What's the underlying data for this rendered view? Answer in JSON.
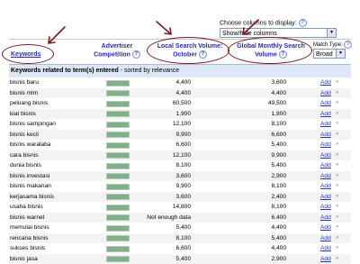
{
  "columns_control": {
    "label": "Choose columns to display:",
    "help": "?",
    "select_value": "Show/hide columns"
  },
  "headers": {
    "keywords": "Keywords",
    "advertiser_line1": "Advertiser",
    "advertiser_line2": "Competition",
    "local_line1": "Local Search Volume:",
    "local_line2": "October",
    "global_line1": "Global Monthly Search",
    "global_line2": "Volume",
    "match_label": "Match Type:",
    "match_value": "Broad",
    "help": "?"
  },
  "section_label": "Keywords related to term(s) entered",
  "section_sort": " - sorted by relevance",
  "rows": [
    {
      "keyword": "bisnis baru",
      "competition": 1.0,
      "local": "4,400",
      "global": "3,600",
      "action": "Add"
    },
    {
      "keyword": "bisnis mlm",
      "competition": 1.0,
      "local": "4,400",
      "global": "4,400",
      "action": "Add"
    },
    {
      "keyword": "peluang bisnis",
      "competition": 1.0,
      "local": "60,500",
      "global": "49,500",
      "action": "Add"
    },
    {
      "keyword": "kiat bisnis",
      "competition": 1.0,
      "local": "1,900",
      "global": "1,900",
      "action": "Add"
    },
    {
      "keyword": "bisnis sampingan",
      "competition": 1.0,
      "local": "12,100",
      "global": "8,100",
      "action": "Add"
    },
    {
      "keyword": "bisnis kecil",
      "competition": 1.0,
      "local": "9,900",
      "global": "6,600",
      "action": "Add"
    },
    {
      "keyword": "bisnis waralaba",
      "competition": 1.0,
      "local": "6,600",
      "global": "5,400",
      "action": "Add"
    },
    {
      "keyword": "cara bisnis",
      "competition": 1.0,
      "local": "12,100",
      "global": "9,900",
      "action": "Add"
    },
    {
      "keyword": "dunia bisnis",
      "competition": 1.0,
      "local": "8,100",
      "global": "5,400",
      "action": "Add"
    },
    {
      "keyword": "bisnis investasi",
      "competition": 1.0,
      "local": "3,600",
      "global": "2,900",
      "action": "Add"
    },
    {
      "keyword": "bisnis makanan",
      "competition": 1.0,
      "local": "9,900",
      "global": "8,100",
      "action": "Add"
    },
    {
      "keyword": "kerjasama bisnis",
      "competition": 1.0,
      "local": "3,600",
      "global": "2,400",
      "action": "Add"
    },
    {
      "keyword": "usaha bisnis",
      "competition": 1.0,
      "local": "14,800",
      "global": "8,100",
      "action": "Add"
    },
    {
      "keyword": "bisnis warnet",
      "competition": 1.0,
      "local": "Not enough data",
      "global": "6,400",
      "action": "Add"
    },
    {
      "keyword": "memulai bisnis",
      "competition": 1.0,
      "local": "5,400",
      "global": "4,400",
      "action": "Add"
    },
    {
      "keyword": "rencana bisnis",
      "competition": 1.0,
      "local": "8,100",
      "global": "5,400",
      "action": "Add"
    },
    {
      "keyword": "sukses bisnis",
      "competition": 1.0,
      "local": "6,600",
      "global": "4,400",
      "action": "Add"
    },
    {
      "keyword": "bisnis jasa",
      "competition": 1.0,
      "local": "5,400",
      "global": "2,900",
      "action": "Add"
    }
  ]
}
